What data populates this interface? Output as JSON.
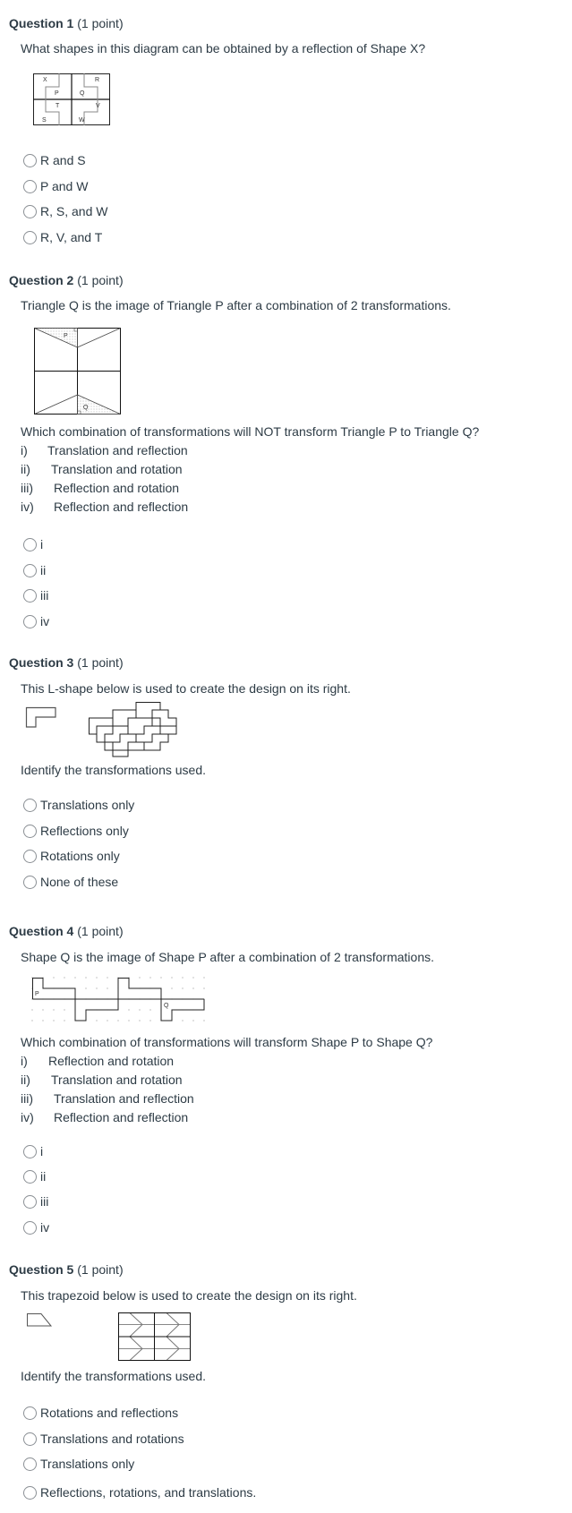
{
  "questions": [
    {
      "title": "Question 1",
      "points": "(1 point)",
      "prompt": "What shapes in this diagram can be obtained by a reflection of Shape X?",
      "figure": {
        "type": "grid-of-shapes",
        "labels": [
          "X",
          "P",
          "R",
          "Q",
          "T",
          "V",
          "S",
          "W"
        ]
      },
      "options": [
        "R and S",
        "P and W",
        "R, S, and W",
        "R, V, and T"
      ]
    },
    {
      "title": "Question 2",
      "points": "(1 point)",
      "prompt": "Triangle Q is the image of Triangle P after a combination of 2 transformations.",
      "figure": {
        "type": "triangles-square",
        "labels": [
          "P",
          "Q"
        ]
      },
      "question": "Which combination of transformations will NOT transform Triangle P to Triangle Q?",
      "choices": [
        {
          "num": "i)",
          "text": "Translation and reflection"
        },
        {
          "num": "ii)",
          "text": "Translation and rotation"
        },
        {
          "num": "iii)",
          "text": "Reflection and rotation"
        },
        {
          "num": "iv)",
          "text": "Reflection and reflection"
        }
      ],
      "options": [
        "i",
        "ii",
        "iii",
        "iv"
      ]
    },
    {
      "title": "Question 3",
      "points": "(1 point)",
      "prompt": "This L-shape below is used to create the design on its right.",
      "figure": {
        "type": "l-shape-tessellation"
      },
      "question": "Identify the transformations used.",
      "options": [
        "Translations only",
        "Reflections only",
        "Rotations only",
        "None of these"
      ]
    },
    {
      "title": "Question 4",
      "points": "(1 point)",
      "prompt": "Shape Q is the image of Shape P after a combination of 2 transformations.",
      "figure": {
        "type": "dot-grid-shapes",
        "labels": [
          "P",
          "Q"
        ]
      },
      "question": "Which combination of transformations will transform Shape P to Shape Q?",
      "choices": [
        {
          "num": "i)",
          "text": "Reflection and rotation"
        },
        {
          "num": "ii)",
          "text": "Translation and rotation"
        },
        {
          "num": "iii)",
          "text": "Translation and reflection"
        },
        {
          "num": "iv)",
          "text": "Reflection and reflection"
        }
      ],
      "options": [
        "i",
        "ii",
        "iii",
        "iv"
      ]
    },
    {
      "title": "Question 5",
      "points": "(1 point)",
      "prompt": "This trapezoid below is used to create the design on its right.",
      "figure": {
        "type": "trapezoid-tessellation"
      },
      "question": "Identify the transformations used.",
      "options": [
        "Rotations and reflections",
        "Translations and rotations",
        "Translations only",
        "Reflections, rotations, and translations."
      ]
    }
  ]
}
